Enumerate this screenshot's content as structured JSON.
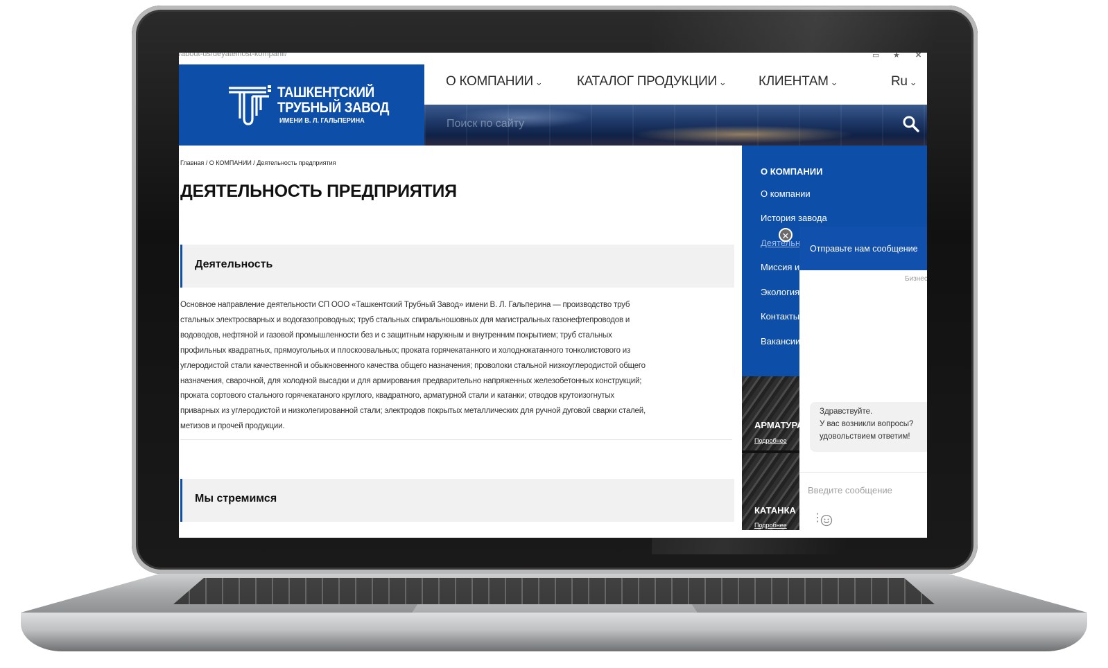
{
  "browser": {
    "url": "/about-us/deyatelnost-kompanii/"
  },
  "logo": {
    "line1": "ТАШКЕНТСКИЙ",
    "line2": "ТРУБНЫЙ ЗАВОД",
    "line3": "ИМЕНИ В. Л. ГАЛЬПЕРИНА"
  },
  "nav": {
    "items": [
      {
        "label": "О КОМПАНИИ"
      },
      {
        "label": "КАТАЛОГ ПРОДУКЦИИ"
      },
      {
        "label": "КЛИЕНТАМ"
      }
    ],
    "language": "Ru"
  },
  "search": {
    "placeholder": "Поиск по сайту"
  },
  "breadcrumb": "Главная / О КОМПАНИИ / Деятельность предприятия",
  "page_title": "ДЕЯТЕЛЬНОСТЬ ПРЕДПРИЯТИЯ",
  "sections": [
    {
      "heading": "Деятельность",
      "lines": [
        "Основное направление деятельности СП ООО «Ташкентский Трубный Завод» имени В. Л. Гальперина — производство труб",
        "стальных электросварных и водогазопроводных; труб стальных спиральношовных для магистральных газонефтепроводов и",
        "водоводов, нефтяной и газовой промышленности без и с защитным наружным и внутренним покрытием; труб стальных",
        "профильных квадратных, прямоугольных и плоскоовальных; проката горячекатанного и холоднокатанного тонколистового из",
        "углеродистой стали качественной и обыкновенного качества общего назначения; проволоки стальной низкоуглеродистой общего",
        "назначения, сварочной, для холодной высадки и для армирования предварительно напряженных железобетонных конструкций;",
        "проката сортового стального горячекатаного круглого, квадратного, арматурной стали и катанки; отводов крутоизогнутых",
        "приварных из углеродистой и низколегированной стали; электродов покрытых металлических для ручной дуговой сварки сталей,",
        "метизов и прочей продукции."
      ]
    },
    {
      "heading": "Мы стремимся"
    }
  ],
  "sidebar": {
    "title": "О КОМПАНИИ",
    "items": [
      {
        "label": "О компании"
      },
      {
        "label": "История завода"
      },
      {
        "label": "Деятельность",
        "active": true
      },
      {
        "label": "Миссия и ценности"
      },
      {
        "label": "Экология"
      },
      {
        "label": "Контакты"
      },
      {
        "label": "Вакансии"
      }
    ]
  },
  "promos": [
    {
      "title": "АРМАТУРА",
      "link": "Подробнее"
    },
    {
      "title": "КАТАНКА",
      "link": "Подробнее"
    }
  ],
  "chat": {
    "header": "Отправьте нам сообщение",
    "company": "Бизнес",
    "greeting": [
      "Здравствуйте.",
      "У вас возникли вопросы?",
      "удовольствием ответим!"
    ],
    "input_placeholder": "Введите сообщение",
    "close_icon": "close-icon",
    "emoji_icon": "emoji-icon",
    "menu_icon": "menu-dots-icon"
  },
  "colors": {
    "brand_blue": "#0d4fa8",
    "chat_blue": "#1250ae",
    "section_bg": "#f1f1f1"
  }
}
